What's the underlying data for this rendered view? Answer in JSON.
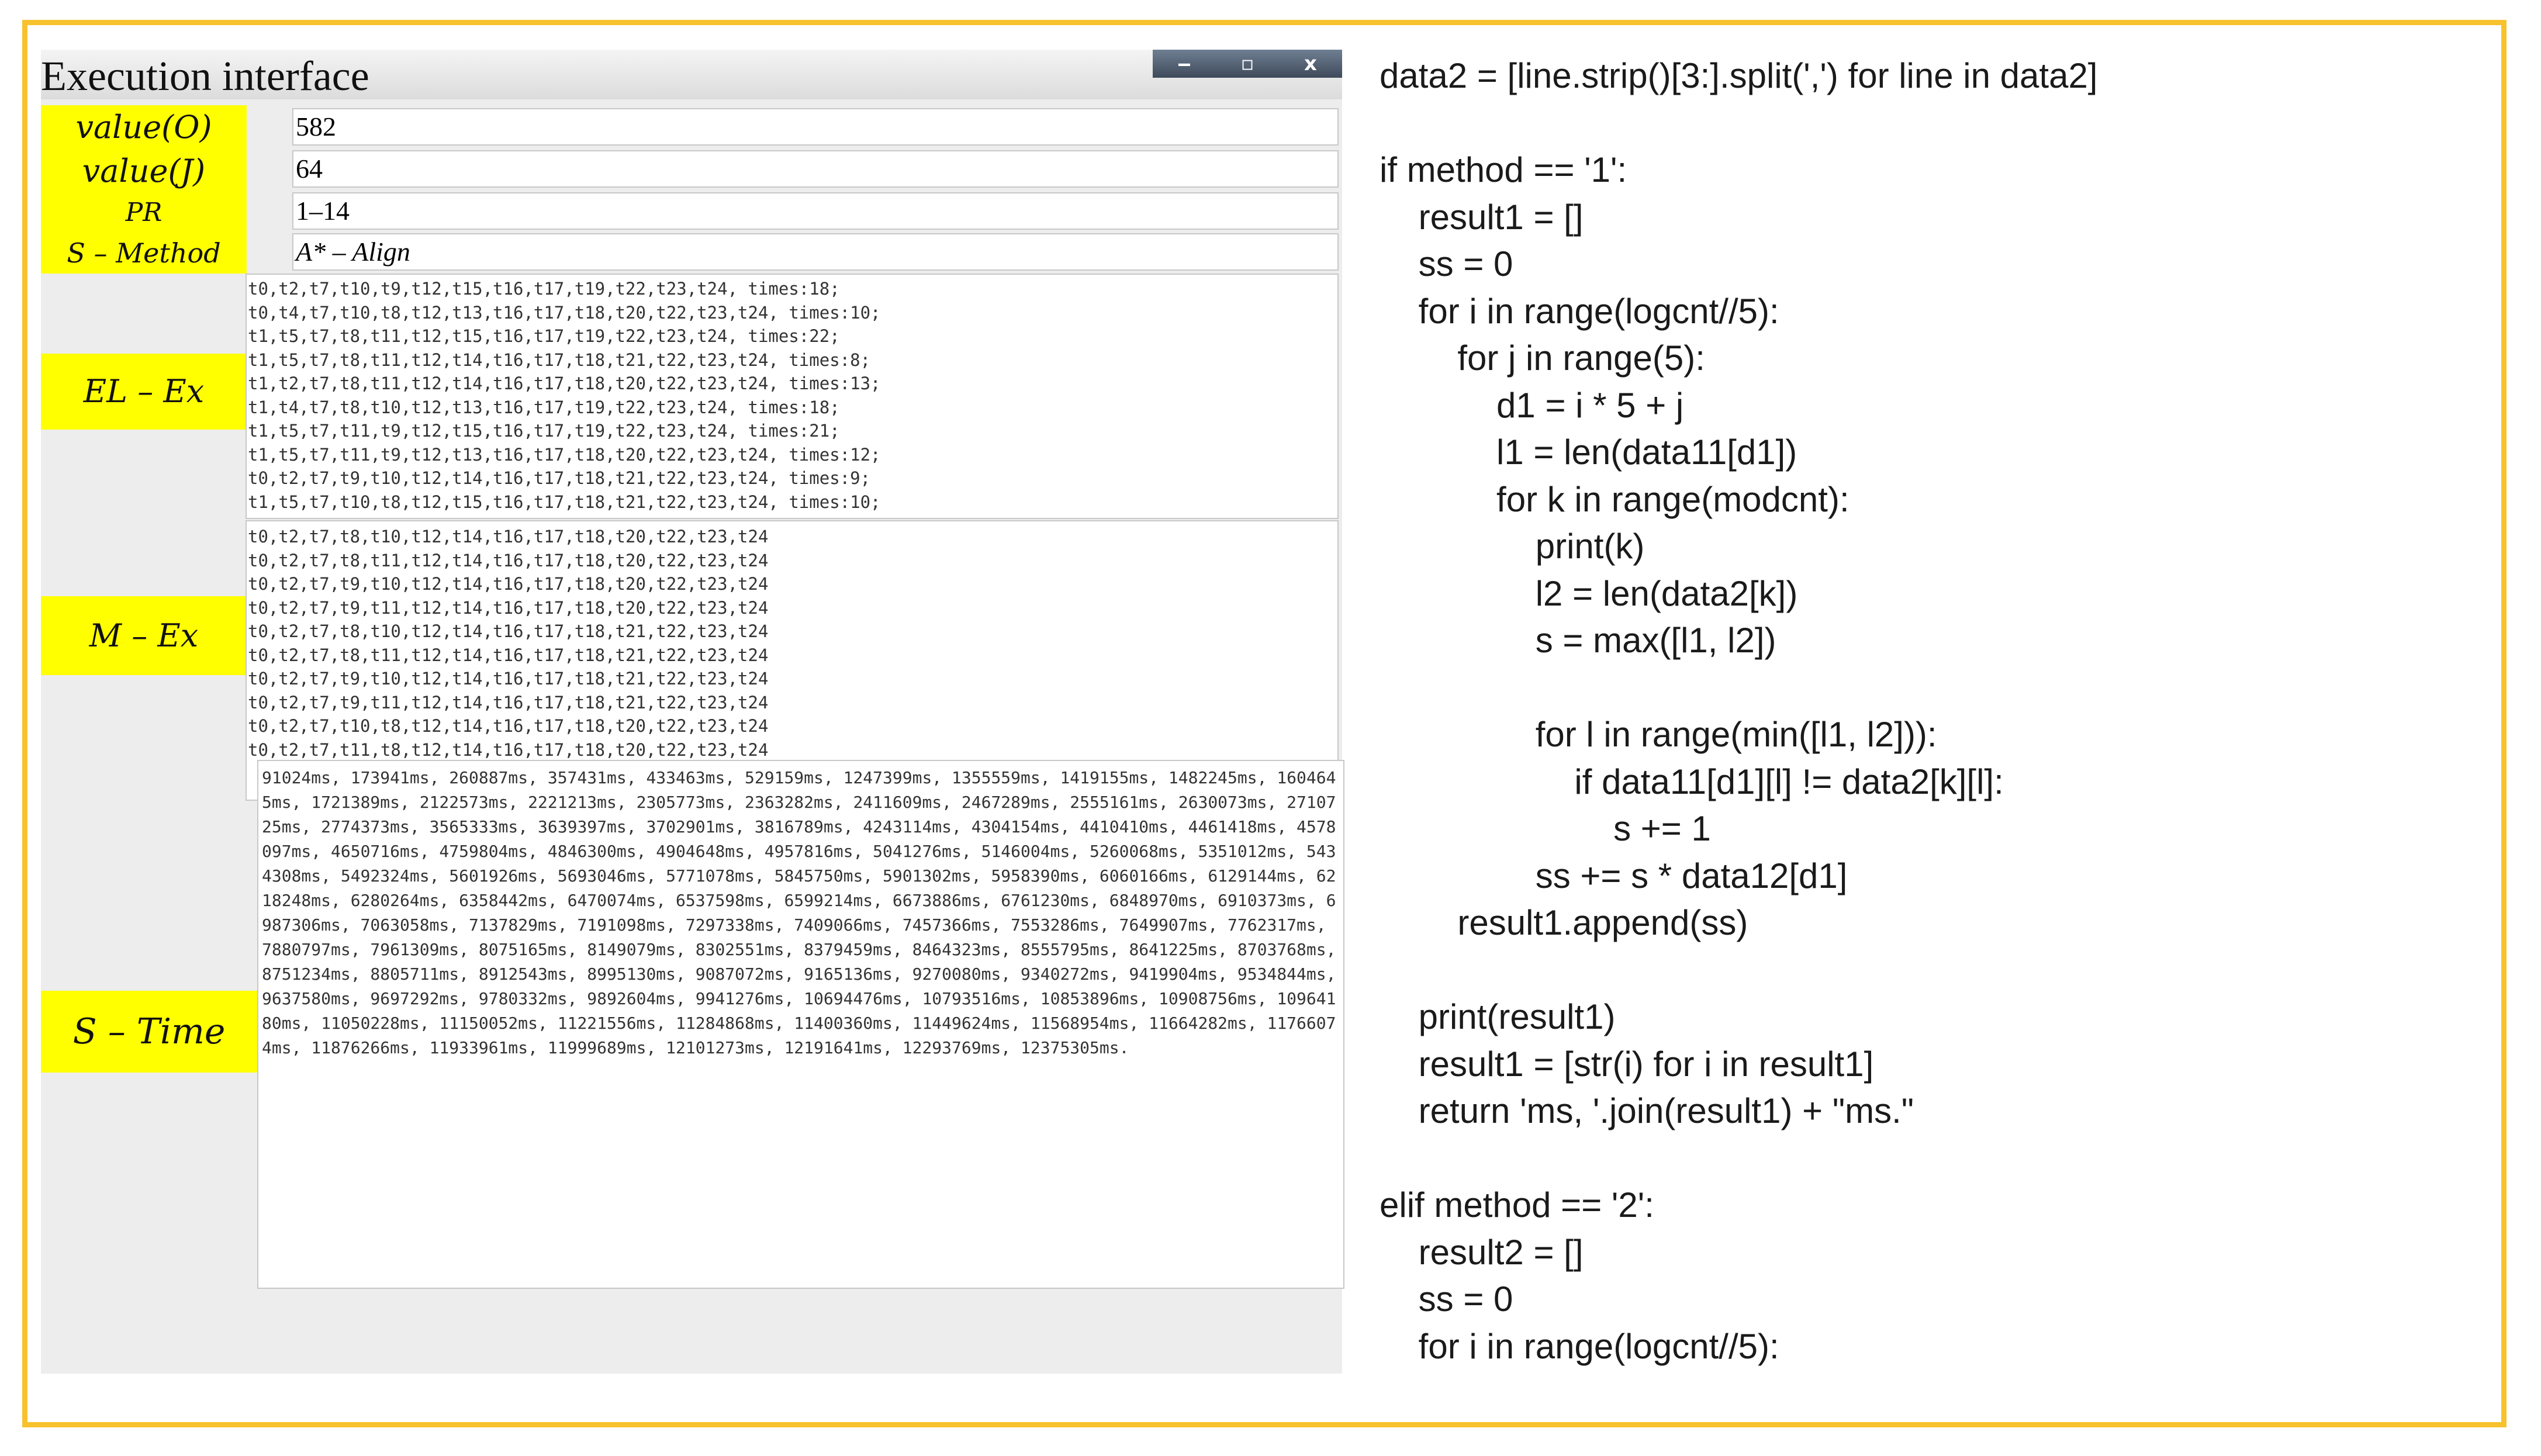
{
  "window": {
    "title": "Execution interface",
    "controls": {
      "minimize": "‒",
      "maximize": "▫",
      "close": "x"
    }
  },
  "fields": {
    "value_o": {
      "label": "value(O)",
      "value": "582"
    },
    "value_j": {
      "label": "value(J)",
      "value": "64"
    },
    "pr": {
      "label": "PR",
      "value": "1–14"
    },
    "s_method": {
      "label": "S – Method",
      "value": "A* – Align"
    }
  },
  "el_ex": {
    "label": "EL – Ex",
    "lines": [
      "t0,t2,t7,t10,t9,t12,t15,t16,t17,t19,t22,t23,t24, times:18;",
      "t0,t4,t7,t10,t8,t12,t13,t16,t17,t18,t20,t22,t23,t24, times:10;",
      "t1,t5,t7,t8,t11,t12,t15,t16,t17,t19,t22,t23,t24, times:22;",
      "t1,t5,t7,t8,t11,t12,t14,t16,t17,t18,t21,t22,t23,t24, times:8;",
      "t1,t2,t7,t8,t11,t12,t14,t16,t17,t18,t20,t22,t23,t24, times:13;",
      "t1,t4,t7,t8,t10,t12,t13,t16,t17,t19,t22,t23,t24, times:18;",
      "t1,t5,t7,t11,t9,t12,t15,t16,t17,t19,t22,t23,t24, times:21;",
      "t1,t5,t7,t11,t9,t12,t13,t16,t17,t18,t20,t22,t23,t24, times:12;",
      "t0,t2,t7,t9,t10,t12,t14,t16,t17,t18,t21,t22,t23,t24, times:9;",
      "t1,t5,t7,t10,t8,t12,t15,t16,t17,t18,t21,t22,t23,t24, times:10;"
    ]
  },
  "m_ex": {
    "label": "M – Ex",
    "lines": [
      "t0,t2,t7,t8,t10,t12,t14,t16,t17,t18,t20,t22,t23,t24",
      "t0,t2,t7,t8,t11,t12,t14,t16,t17,t18,t20,t22,t23,t24",
      "t0,t2,t7,t9,t10,t12,t14,t16,t17,t18,t20,t22,t23,t24",
      "t0,t2,t7,t9,t11,t12,t14,t16,t17,t18,t20,t22,t23,t24",
      "t0,t2,t7,t8,t10,t12,t14,t16,t17,t18,t21,t22,t23,t24",
      "t0,t2,t7,t8,t11,t12,t14,t16,t17,t18,t21,t22,t23,t24",
      "t0,t2,t7,t9,t10,t12,t14,t16,t17,t18,t21,t22,t23,t24",
      "t0,t2,t7,t9,t11,t12,t14,t16,t17,t18,t21,t22,t23,t24",
      "t0,t2,t7,t10,t8,t12,t14,t16,t17,t18,t20,t22,t23,t24",
      "t0,t2,t7,t11,t8,t12,t14,t16,t17,t18,t20,t22,t23,t24"
    ]
  },
  "s_time": {
    "label": "S – Time",
    "text": "91024ms, 173941ms, 260887ms, 357431ms, 433463ms, 529159ms, 1247399ms, 1355559ms, 1419155ms, 1482245ms, 1604645ms, 1721389ms, 2122573ms, 2221213ms, 2305773ms, 2363282ms, 2411609ms, 2467289ms, 2555161ms, 2630073ms, 2710725ms, 2774373ms, 3565333ms, 3639397ms, 3702901ms, 3816789ms, 4243114ms, 4304154ms, 4410410ms, 4461418ms, 4578097ms, 4650716ms, 4759804ms, 4846300ms, 4904648ms, 4957816ms, 5041276ms, 5146004ms, 5260068ms, 5351012ms, 5434308ms, 5492324ms, 5601926ms, 5693046ms, 5771078ms, 5845750ms, 5901302ms, 5958390ms, 6060166ms, 6129144ms, 6218248ms, 6280264ms, 6358442ms, 6470074ms, 6537598ms, 6599214ms, 6673886ms, 6761230ms, 6848970ms, 6910373ms, 6987306ms, 7063058ms, 7137829ms, 7191098ms, 7297338ms, 7409066ms, 7457366ms, 7553286ms, 7649907ms, 7762317ms, 7880797ms, 7961309ms, 8075165ms, 8149079ms, 8302551ms, 8379459ms, 8464323ms, 8555795ms, 8641225ms, 8703768ms, 8751234ms, 8805711ms, 8912543ms, 8995130ms, 9087072ms, 9165136ms, 9270080ms, 9340272ms, 9419904ms, 9534844ms, 9637580ms, 9697292ms, 9780332ms, 9892604ms, 9941276ms, 10694476ms, 10793516ms, 10853896ms, 10908756ms, 10964180ms, 11050228ms, 11150052ms, 11221556ms, 11284868ms, 11400360ms, 11449624ms, 11568954ms, 11664282ms, 11766074ms, 11876266ms, 11933961ms, 11999689ms, 12101273ms, 12191641ms, 12293769ms, 12375305ms."
  },
  "code": [
    "data2 = [line.strip()[3:].split(',') for line in data2]",
    "",
    "if method == '1':",
    "    result1 = []",
    "    ss = 0",
    "    for i in range(logcnt//5):",
    "        for j in range(5):",
    "            d1 = i * 5 + j",
    "            l1 = len(data11[d1])",
    "            for k in range(modcnt):",
    "                print(k)",
    "                l2 = len(data2[k])",
    "                s = max([l1, l2])",
    "",
    "                for l in range(min([l1, l2])):",
    "                    if data11[d1][l] != data2[k][l]:",
    "                        s += 1",
    "                ss += s * data12[d1]",
    "        result1.append(ss)",
    "",
    "    print(result1)",
    "    result1 = [str(i) for i in result1]",
    "    return 'ms, '.join(result1) + \"ms.\"",
    "",
    "elif method == '2':",
    "    result2 = []",
    "    ss = 0",
    "    for i in range(logcnt//5):"
  ]
}
